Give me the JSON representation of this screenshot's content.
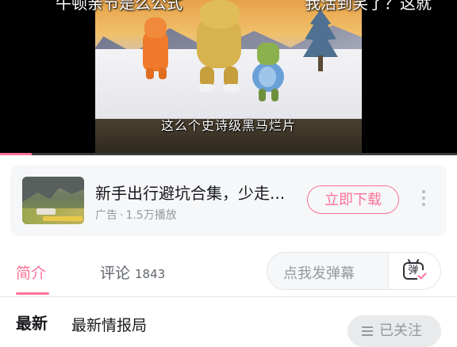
{
  "player": {
    "top_caption_left": "牛顿亲节是么公式",
    "top_caption_right": "我活到笑了？这就",
    "subtitle": "这么个史诗级黑马烂片",
    "progress_fraction": 0.07
  },
  "ad": {
    "title": "新手出行避坑合集，少走...",
    "label": "广告",
    "separator": "·",
    "plays": "1.5万播放",
    "download_button": "立即下载",
    "more_icon": "more-vertical-icon"
  },
  "tabs": {
    "intro": "简介",
    "comments": "评论",
    "comments_count": "1843"
  },
  "danmaku": {
    "placeholder": "点我发弹幕",
    "toggle_icon": "danmaku-toggle-icon",
    "toggle_glyph": "弹"
  },
  "uploader": {
    "avatar_text": "最新",
    "name": "最新情报局",
    "stats": "",
    "follow_label": "已关注"
  },
  "colors": {
    "accent": "#fb7299",
    "muted_text": "#9499a0"
  }
}
